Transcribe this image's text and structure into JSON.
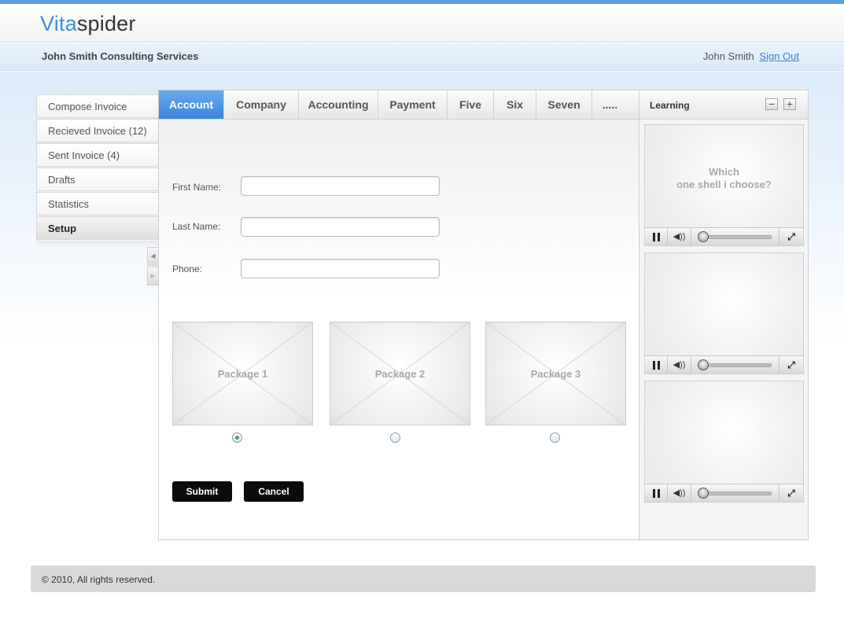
{
  "header": {
    "logo_part1": "Vita",
    "logo_part2": "spider",
    "company": "John Smith Consulting Services",
    "user_name": "John Smith",
    "signout_label": "Sign Out"
  },
  "sidebar": {
    "items": [
      {
        "label": "Compose Invoice"
      },
      {
        "label": "Recieved Invoice (12)"
      },
      {
        "label": "Sent Invoice (4)"
      },
      {
        "label": "Drafts"
      },
      {
        "label": "Statistics"
      },
      {
        "label": "Setup"
      }
    ],
    "active": "Setup"
  },
  "tabs": [
    "Account",
    "Company",
    "Accounting",
    "Payment",
    "Five",
    "Six",
    "Seven",
    "....."
  ],
  "form": {
    "first_name_label": "First Name:",
    "last_name_label": "Last Name:",
    "phone_label": "Phone:",
    "first_name_value": "",
    "last_name_value": "",
    "phone_value": ""
  },
  "packages": [
    {
      "label": "Package 1",
      "selected": true
    },
    {
      "label": "Package 2",
      "selected": false
    },
    {
      "label": "Package 3",
      "selected": false
    }
  ],
  "buttons": {
    "submit": "Submit",
    "cancel": "Cancel"
  },
  "learning": {
    "title": "Learning",
    "minus": "−",
    "plus": "+",
    "video1_line1": "Which",
    "video1_line2": "one shell i choose?"
  },
  "footer": {
    "text": "© 2010, All rights reserved."
  },
  "colors": {
    "accent": "#3f8fdc",
    "active_tab": "#4a93e0",
    "button": "#0b0b0b"
  }
}
